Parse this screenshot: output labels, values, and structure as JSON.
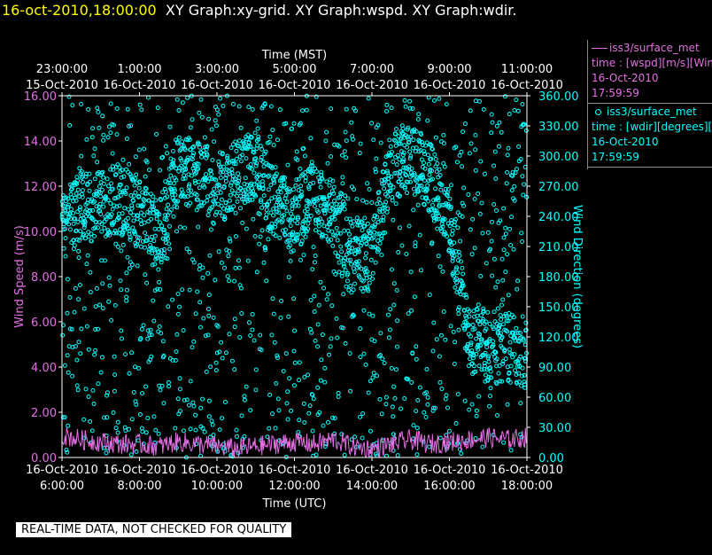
{
  "header": {
    "datetime": "16-oct-2010,18:00:00",
    "titles": "XY Graph:xy-grid.  XY Graph:wspd.  XY Graph:wdir."
  },
  "legend": {
    "series1": {
      "name": "iss3/surface_met",
      "desc": "time : [wspd][m/s][Wind",
      "date": "16-Oct-2010",
      "time": "17:59:59"
    },
    "series2": {
      "name": "iss3/surface_met",
      "desc": "time : [wdir][degrees][W",
      "date": "16-Oct-2010",
      "time": "17:59:59"
    }
  },
  "banner": "REAL-TIME DATA, NOT CHECKED FOR QUALITY",
  "colors": {
    "speed": "#e36fe3",
    "direction": "#00ffff",
    "background": "#000000",
    "date": "#ffff00"
  },
  "chart_data": {
    "type": "scatter",
    "top_axis_title": "Time (MST)",
    "bottom_axis_title": "Time (UTC)",
    "left_axis_title": "Wind Speed (m/s)",
    "right_axis_title": "Wind Direction (degrees)",
    "x_range_utc_hours": [
      6,
      18
    ],
    "top_ticks": [
      {
        "time": "23:00:00",
        "date": "15-Oct-2010"
      },
      {
        "time": "1:00:00",
        "date": "16-Oct-2010"
      },
      {
        "time": "3:00:00",
        "date": "16-Oct-2010"
      },
      {
        "time": "5:00:00",
        "date": "16-Oct-2010"
      },
      {
        "time": "7:00:00",
        "date": "16-Oct-2010"
      },
      {
        "time": "9:00:00",
        "date": "16-Oct-2010"
      },
      {
        "time": "11:00:00",
        "date": "16-Oct-2010"
      }
    ],
    "bottom_ticks": [
      {
        "date": "16-Oct-2010",
        "time": "6:00:00"
      },
      {
        "date": "16-Oct-2010",
        "time": "8:00:00"
      },
      {
        "date": "16-Oct-2010",
        "time": "10:00:00"
      },
      {
        "date": "16-Oct-2010",
        "time": "12:00:00"
      },
      {
        "date": "16-Oct-2010",
        "time": "14:00:00"
      },
      {
        "date": "16-Oct-2010",
        "time": "16:00:00"
      },
      {
        "date": "16-Oct-2010",
        "time": "18:00:00"
      }
    ],
    "left_ylim": [
      0,
      16
    ],
    "left_ticks": [
      "0.00",
      "2.00",
      "4.00",
      "6.00",
      "8.00",
      "10.00",
      "12.00",
      "14.00",
      "16.00"
    ],
    "right_ylim": [
      0,
      360
    ],
    "right_ticks": [
      "0.00",
      "30.00",
      "60.00",
      "90.00",
      "120.00",
      "150.00",
      "180.00",
      "210.00",
      "240.00",
      "270.00",
      "300.00",
      "330.00",
      "360.00"
    ],
    "series": [
      {
        "name": "iss3/surface_met wspd",
        "axis": "left",
        "style": "line",
        "hours": [
          6.0,
          6.5,
          7.0,
          7.5,
          8.0,
          8.5,
          9.0,
          9.5,
          10.0,
          10.5,
          11.0,
          11.5,
          12.0,
          12.5,
          13.0,
          13.5,
          14.0,
          14.5,
          15.0,
          15.5,
          16.0,
          16.5,
          17.0,
          17.5,
          18.0
        ],
        "values": [
          0.9,
          0.7,
          0.6,
          0.5,
          0.5,
          0.4,
          0.6,
          0.5,
          0.4,
          0.3,
          0.4,
          0.5,
          0.6,
          0.5,
          0.7,
          0.4,
          0.3,
          0.5,
          0.7,
          0.5,
          0.6,
          0.7,
          0.8,
          0.7,
          0.8
        ]
      },
      {
        "name": "iss3/surface_met wdir",
        "axis": "right",
        "style": "markers",
        "hours": [
          6.0,
          6.5,
          7.0,
          7.5,
          8.0,
          8.5,
          9.0,
          9.5,
          10.0,
          10.5,
          11.0,
          11.5,
          12.0,
          12.5,
          13.0,
          13.5,
          14.0,
          14.5,
          15.0,
          15.5,
          16.0,
          16.5,
          17.0,
          17.5,
          18.0
        ],
        "values": [
          230,
          250,
          250,
          260,
          240,
          220,
          290,
          280,
          270,
          280,
          290,
          250,
          240,
          260,
          240,
          200,
          200,
          290,
          300,
          280,
          230,
          120,
          110,
          110,
          100
        ]
      }
    ]
  }
}
